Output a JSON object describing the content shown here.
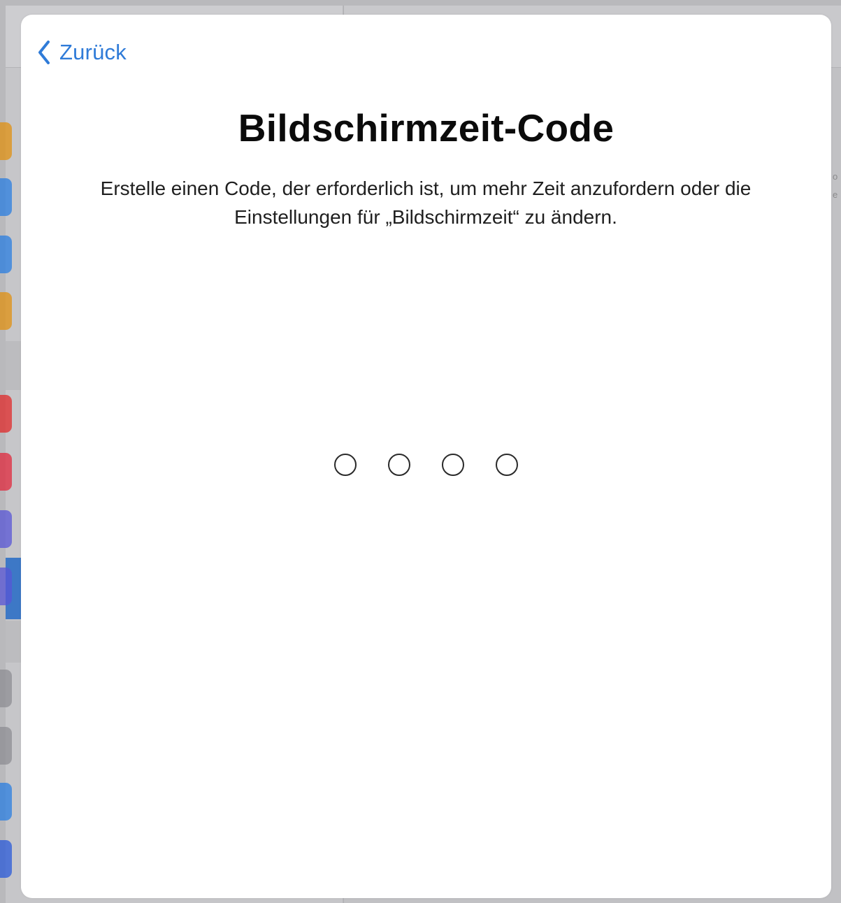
{
  "window": {
    "dimmed_background": "settings-split-view"
  },
  "sheet": {
    "back_label": "Zurück",
    "back_icon": "chevron-left-icon",
    "title": "Bildschirmzeit-Code",
    "subtitle": "Erstelle einen Code, der erforderlich ist, um mehr Zeit anzufordern oder die Einstellungen für „Bildschirmzeit“ zu ändern.",
    "passcode": {
      "length": 4,
      "entered": 0
    }
  },
  "colors": {
    "accent": "#2f7bd8",
    "sheet_background": "#ffffff",
    "dim_background": "#b9b9bc",
    "selected_row": "#3d78c6",
    "sidebar_icons": [
      "#e09010",
      "#2a7de0",
      "#2a7de0",
      "#e09010",
      "#e02a2a",
      "#e0283c",
      "#5856d6",
      "#5856d6",
      "#8e8e93",
      "#8e8e93",
      "#2a7de0",
      "#2a5ad8"
    ]
  }
}
